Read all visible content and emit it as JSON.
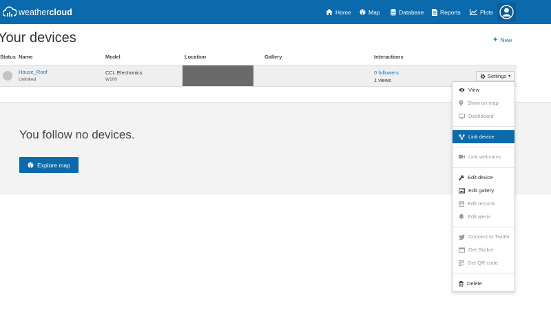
{
  "navbar": {
    "brand_light": "weather",
    "brand_bold": "cloud",
    "items": [
      {
        "label": "Home",
        "icon": "home-icon"
      },
      {
        "label": "Map",
        "icon": "globe-icon"
      },
      {
        "label": "Database",
        "icon": "database-icon"
      },
      {
        "label": "Reports",
        "icon": "document-icon"
      },
      {
        "label": "Plots",
        "icon": "chart-icon"
      }
    ],
    "avatar_icon": "user-avatar-icon"
  },
  "page": {
    "title": "Your devices",
    "new_label": "New"
  },
  "table": {
    "headers": {
      "status": "Status",
      "name": "Name",
      "model": "Model",
      "location": "Location",
      "gallery": "Gallery",
      "interactions": "Interactions"
    },
    "rows": [
      {
        "name": "House_Roof",
        "link_status": "Unlinked",
        "model_brand": "CCL Electronics",
        "model_code": "W100",
        "followers": "0 followers",
        "views": "1 views",
        "settings_label": "Settings"
      }
    ]
  },
  "follow": {
    "message": "You follow no devices.",
    "explore_label": "Explore map"
  },
  "dropdown": {
    "items": [
      {
        "label": "View",
        "icon": "eye-icon",
        "state": "normal"
      },
      {
        "label": "Show on map",
        "icon": "map-marker-icon",
        "state": "disabled"
      },
      {
        "label": "Dashboard",
        "icon": "monitor-icon",
        "state": "disabled"
      },
      {
        "label": "Link device",
        "icon": "sitemap-icon",
        "state": "active"
      },
      {
        "label": "Link webcams",
        "icon": "video-camera-icon",
        "state": "disabled"
      },
      {
        "label": "Edit device",
        "icon": "wrench-icon",
        "state": "normal"
      },
      {
        "label": "Edit gallery",
        "icon": "image-icon",
        "state": "normal"
      },
      {
        "label": "Edit records",
        "icon": "calendar-icon",
        "state": "disabled"
      },
      {
        "label": "Edit alerts",
        "icon": "bell-icon",
        "state": "disabled"
      },
      {
        "label": "Connect to Twitter",
        "icon": "twitter-icon",
        "state": "disabled"
      },
      {
        "label": "Get Sticker",
        "icon": "browser-window-icon",
        "state": "disabled"
      },
      {
        "label": "Get QR code",
        "icon": "qrcode-icon",
        "state": "disabled"
      },
      {
        "label": "Delete",
        "icon": "trash-icon",
        "state": "normal"
      }
    ]
  },
  "colors": {
    "brand_blue": "#0a6aab",
    "link_blue": "#1777b9",
    "row_background": "#efefef",
    "panel_background": "#f3f3f3"
  }
}
